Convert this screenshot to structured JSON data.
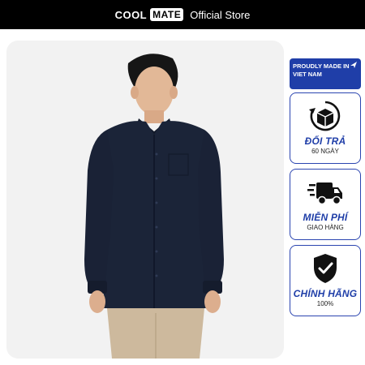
{
  "header": {
    "brand_part1": "COOL",
    "brand_part2": "MATE",
    "store_label": "Official Store"
  },
  "product_image": {
    "alt": "Navy long-sleeve button-down shirt with khaki trousers"
  },
  "badges": {
    "made_in": "PROUDLY MADE IN VIET NAM",
    "return": {
      "title": "ĐỔI TRẢ",
      "subtitle": "60 NGÀY",
      "icon": "box-return-icon"
    },
    "shipping": {
      "title": "MIỄN PHÍ",
      "subtitle": "GIAO HÀNG",
      "icon": "delivery-truck-icon"
    },
    "authentic": {
      "title": "CHÍNH HÃNG",
      "subtitle": "100%",
      "icon": "shield-check-icon"
    }
  },
  "colors": {
    "header_bg": "#000000",
    "accent_blue": "#1f3ea8",
    "photo_bg": "#f2f2f2",
    "shirt": "#1b2438",
    "pants": "#cdb99d"
  }
}
